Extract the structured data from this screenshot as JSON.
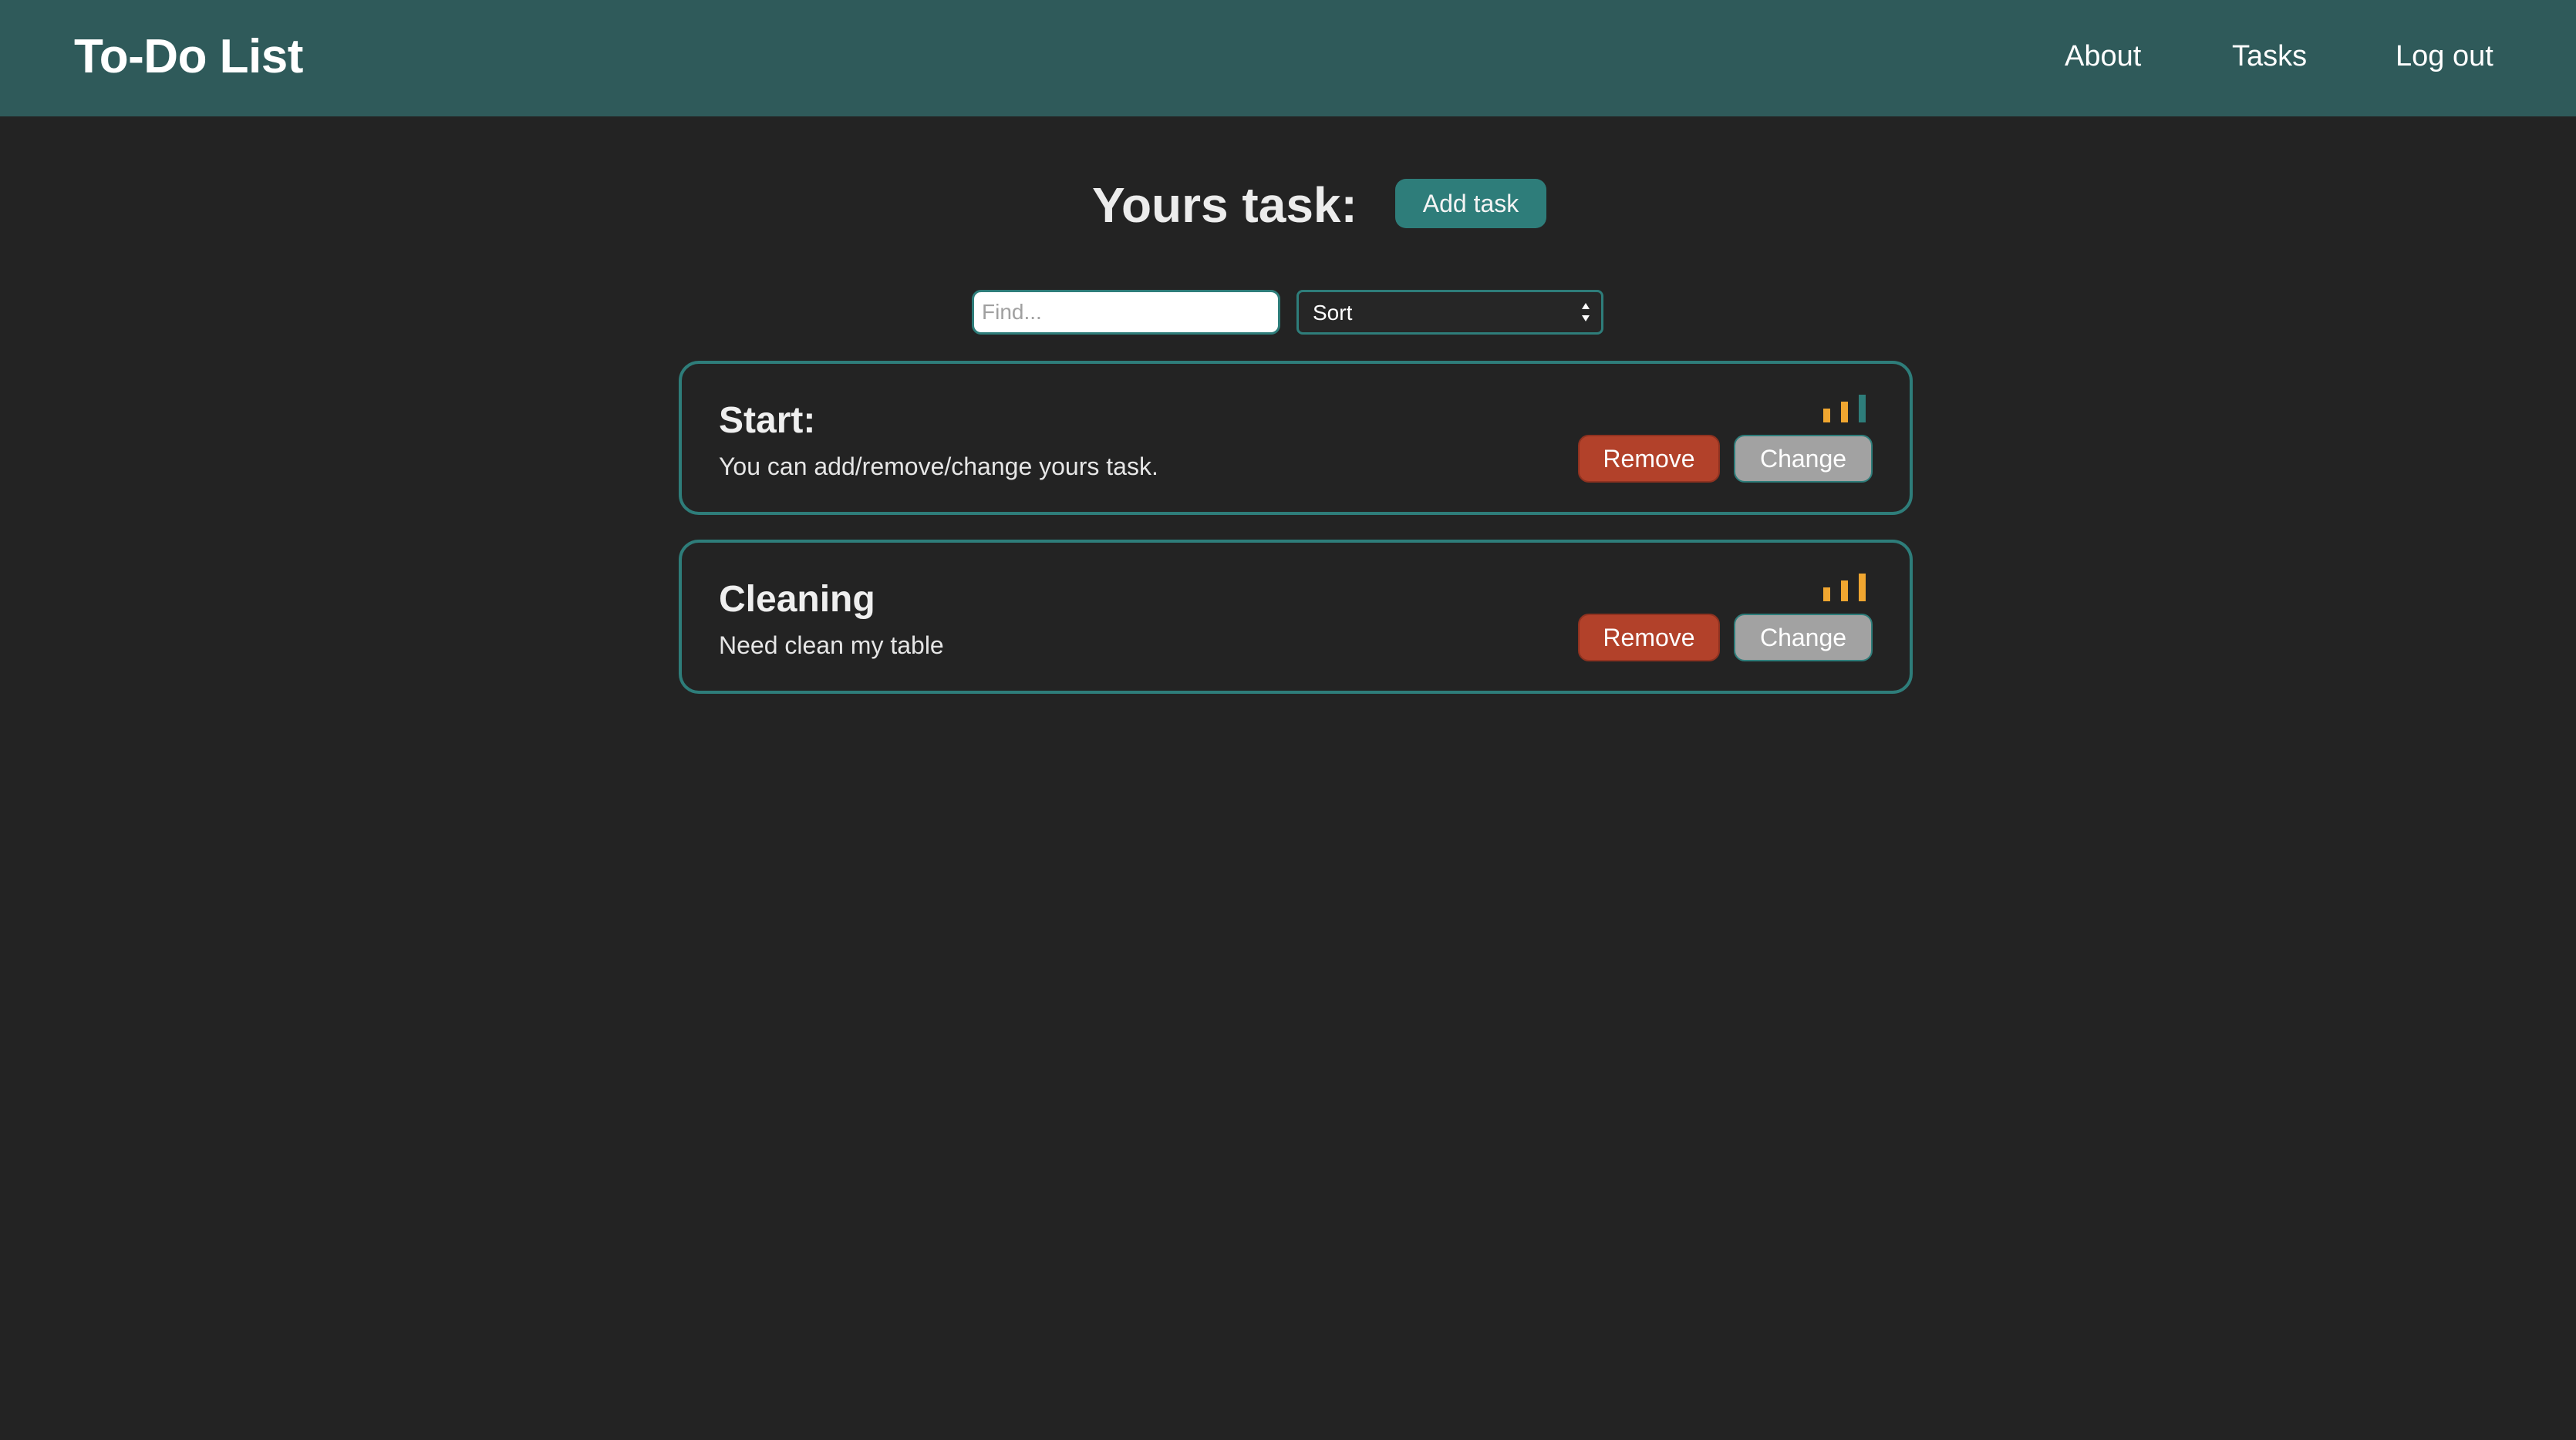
{
  "navbar": {
    "brand": "To-Do List",
    "links": [
      "About",
      "Tasks",
      "Log out"
    ]
  },
  "header": {
    "title": "Yours task:",
    "add_task_label": "Add task"
  },
  "filters": {
    "find_placeholder": "Find...",
    "find_value": "",
    "sort_selected": "Sort"
  },
  "tasks": [
    {
      "title": "Start:",
      "description": "You can add/remove/change yours task.",
      "priority_icon": "priority-bars-icon",
      "priority_level": 2,
      "priority_max": 3,
      "remove_label": "Remove",
      "change_label": "Change"
    },
    {
      "title": "Cleaning",
      "description": "Need clean my table",
      "priority_icon": "priority-bars-icon",
      "priority_level": 3,
      "priority_max": 3,
      "remove_label": "Remove",
      "change_label": "Change"
    }
  ],
  "colors": {
    "navbar": "#2f5a5a",
    "background": "#232323",
    "accent": "#2e7d7a",
    "remove": "#b2412a",
    "change": "#a2a2a2",
    "priority_active": "#f0a630",
    "priority_inactive": "#2e7d7a"
  }
}
